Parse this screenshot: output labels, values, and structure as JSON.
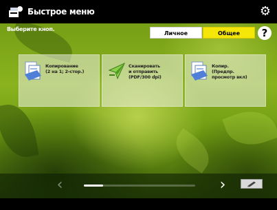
{
  "titlebar": {
    "title": "Быстрое меню",
    "icon": "quick-menu-icon",
    "settings_icon": "gear-icon"
  },
  "instruction": "Выберите кноп.",
  "tabs": {
    "personal": {
      "label": "Личное",
      "selected": false
    },
    "shared": {
      "label": "Общее",
      "selected": true
    }
  },
  "help": {
    "label": "?",
    "icon": "help-icon"
  },
  "buttons": [
    {
      "label": "Копирование\n(2 на 1; 2-стор.)",
      "icon": "copy-icon"
    },
    {
      "label": "Сканировать\nи отправить\n(PDF/300 dpi)",
      "icon": "scan-send-icon"
    },
    {
      "label": "Копир.\n(Предпр.\nпросмотр вкл)",
      "icon": "copy-preview-icon"
    }
  ],
  "pager": {
    "prev_icon": "chevron-left-icon",
    "next_icon": "chevron-right-icon",
    "position_fraction": 0.17
  },
  "edit_icon": "edit-icon",
  "colors": {
    "accent_tab": "#f5e60a",
    "titlebar": "#000000"
  }
}
